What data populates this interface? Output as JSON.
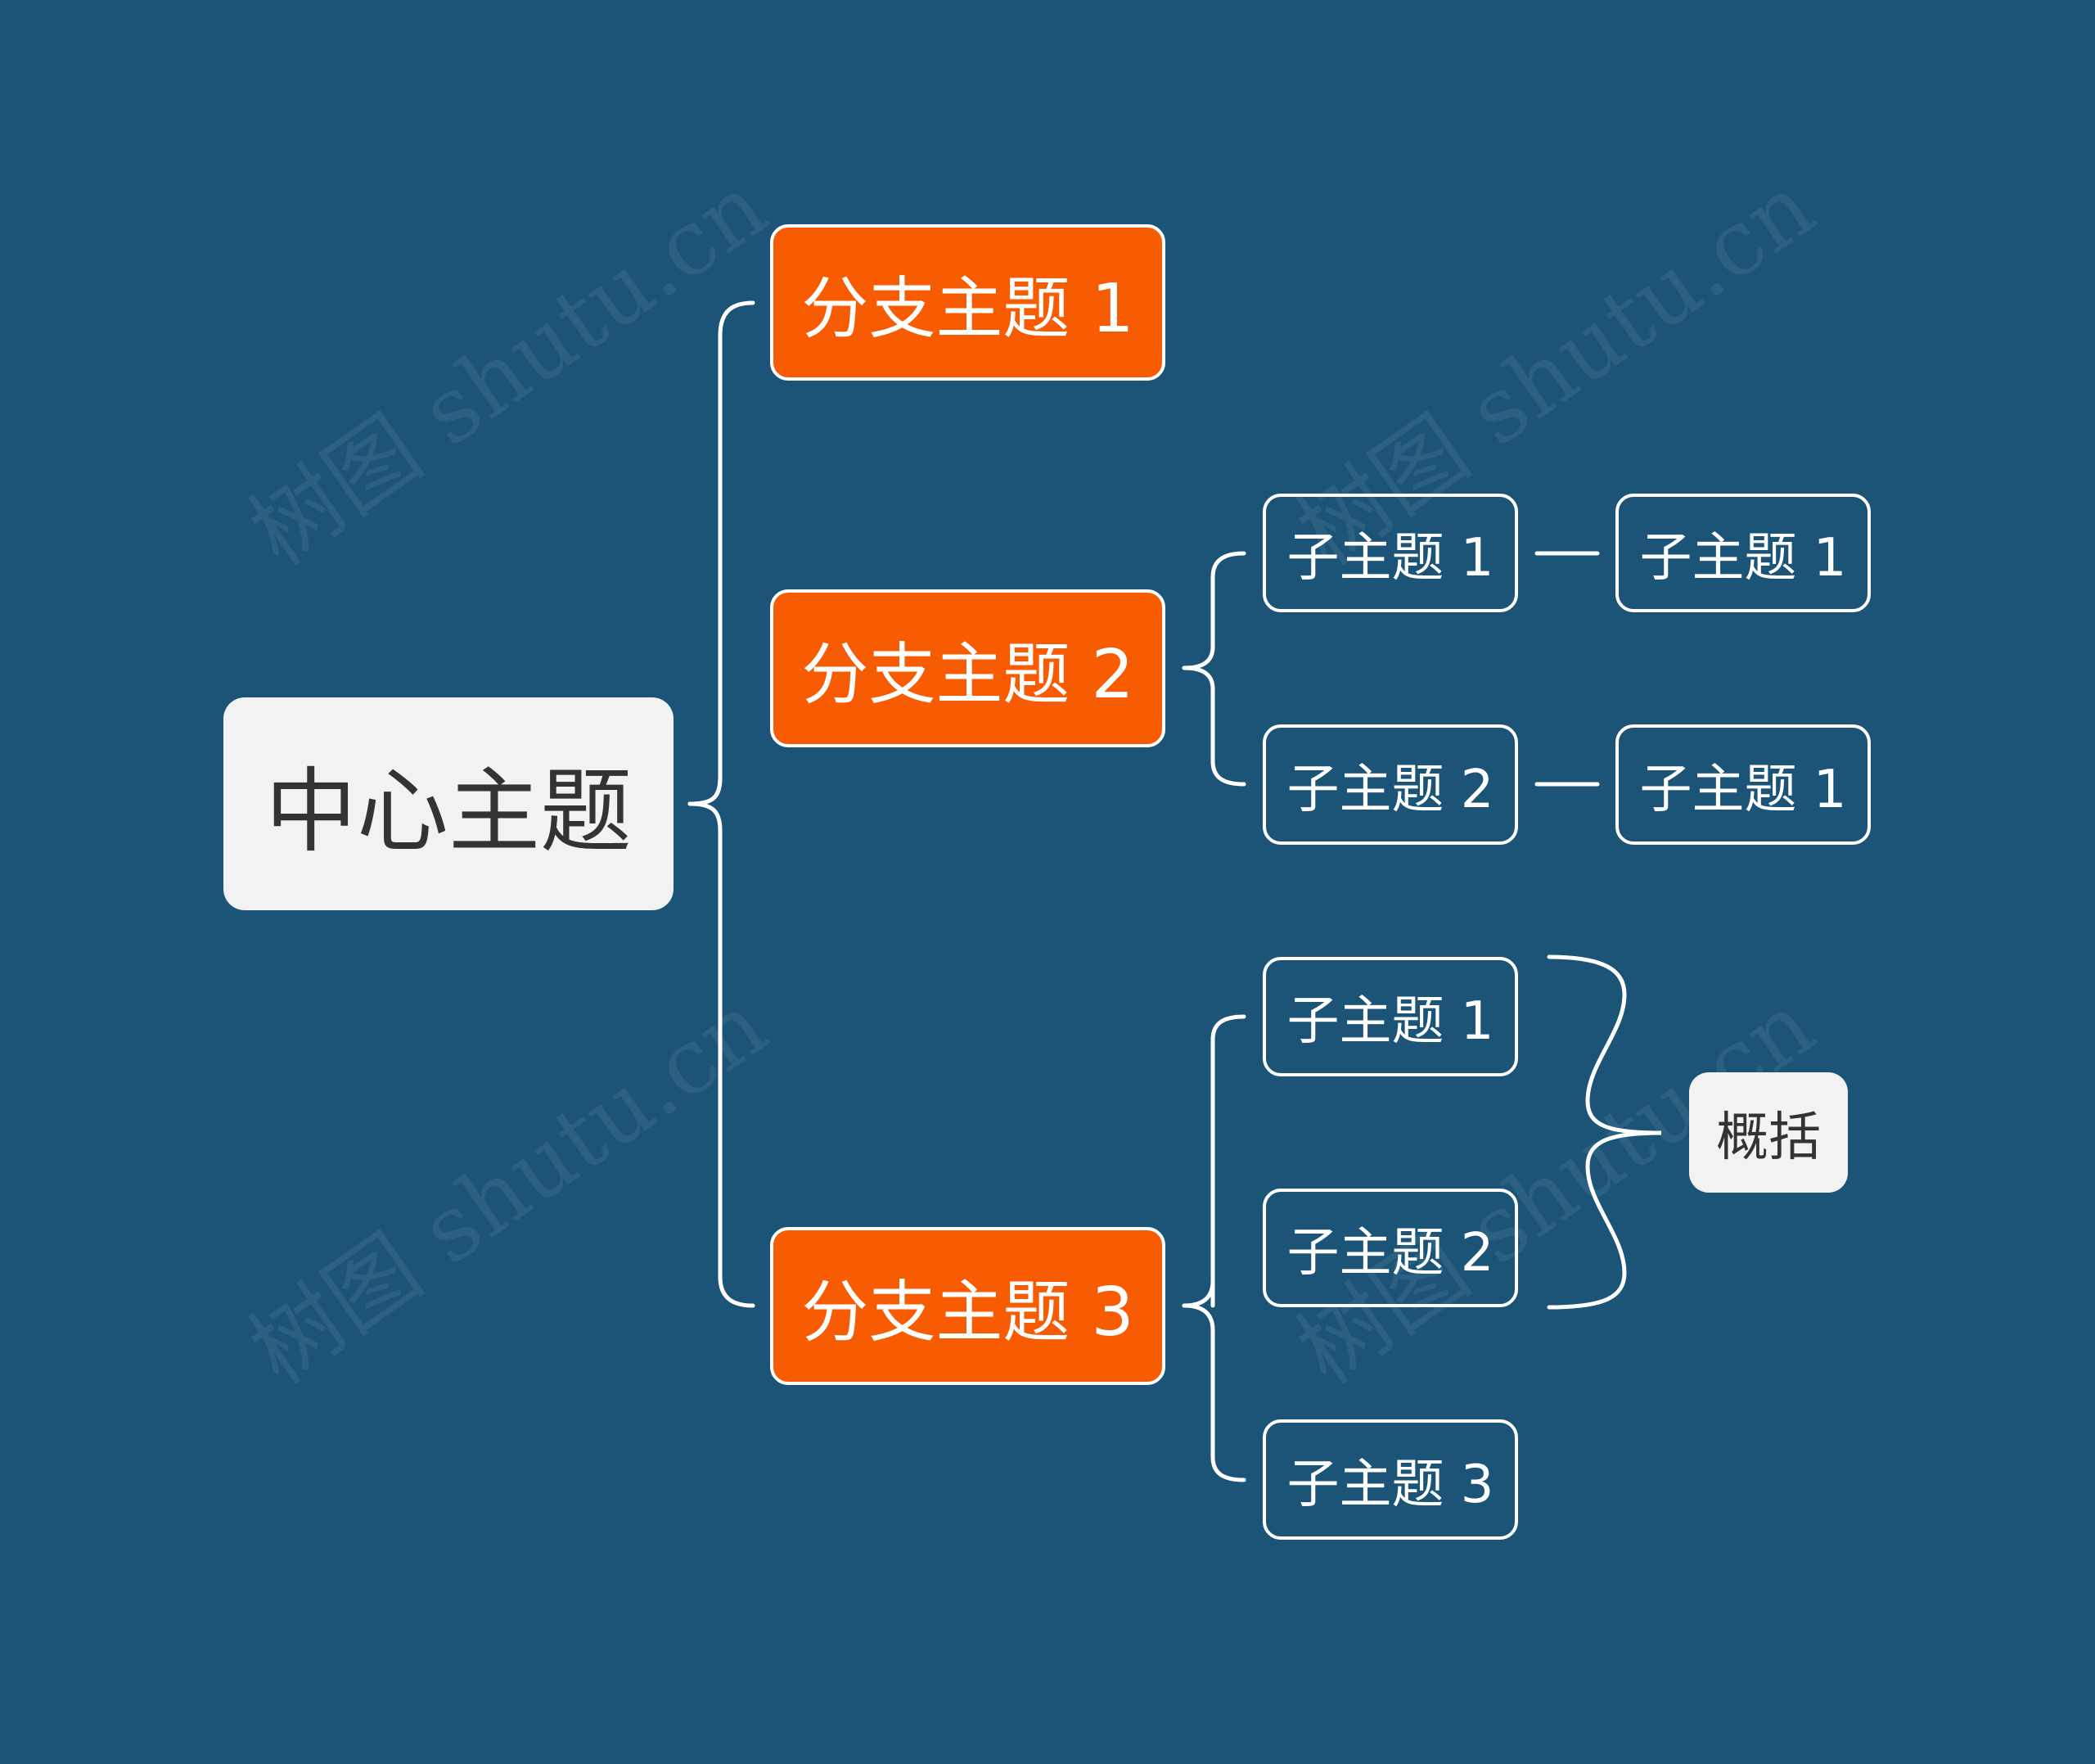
{
  "colors": {
    "background": "#1B5477",
    "branch_fill": "#F75C03",
    "central_fill": "#F2F2F2",
    "line": "#FFFFFF"
  },
  "central": {
    "label": "中心主题"
  },
  "branches": [
    {
      "label": "分支主题 1",
      "children": []
    },
    {
      "label": "分支主题 2",
      "children": [
        {
          "label": "子主题 1",
          "children": [
            {
              "label": "子主题 1"
            }
          ]
        },
        {
          "label": "子主题 2",
          "children": [
            {
              "label": "子主题 1"
            }
          ]
        }
      ]
    },
    {
      "label": "分支主题 3",
      "children": [
        {
          "label": "子主题 1"
        },
        {
          "label": "子主题 2"
        },
        {
          "label": "子主题 3"
        }
      ]
    }
  ],
  "summary": {
    "label": "概括",
    "covers": [
      "分支主题 3 / 子主题 1",
      "分支主题 3 / 子主题 2"
    ]
  },
  "watermark": "树图 shutu.cn"
}
